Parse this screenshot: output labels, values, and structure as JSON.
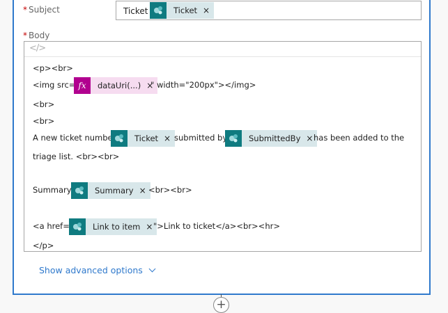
{
  "subject": {
    "label": "Subject",
    "text": "Ticket",
    "token": {
      "label": "Ticket",
      "close": "×",
      "icon": "sharepoint-icon"
    }
  },
  "body": {
    "label": "Body",
    "code_icon": "</>",
    "lines": [
      "<p><br>",
      "<img src=\"",
      "\" width=\"200px\"></img>",
      "<br>",
      "<br>",
      "A new ticket number",
      "submitted by",
      "has been added to the",
      "triage list. <br><br>",
      "Summary:",
      "<br><br>",
      "<a href=\"",
      "\">Link to ticket</a><br><hr>",
      "</p>"
    ],
    "tokens": {
      "datauri": {
        "label": "dataUri(...)",
        "icon_text": "fx",
        "icon": "function-icon",
        "close": "×"
      },
      "ticket": {
        "label": "Ticket",
        "icon": "sharepoint-icon",
        "close": "×"
      },
      "submittedby": {
        "label": "SubmittedBy",
        "icon": "sharepoint-icon",
        "close": "×"
      },
      "summary": {
        "label": "Summary",
        "icon": "sharepoint-icon",
        "close": "×"
      },
      "link": {
        "label": "Link to item",
        "icon": "sharepoint-icon",
        "close": "×"
      }
    }
  },
  "advanced_options": "Show advanced options",
  "add_step": "+",
  "colors": {
    "accent": "#2f79cc",
    "sharepoint": "#0f7b80",
    "function": "#b1008f",
    "required": "#c40000"
  }
}
